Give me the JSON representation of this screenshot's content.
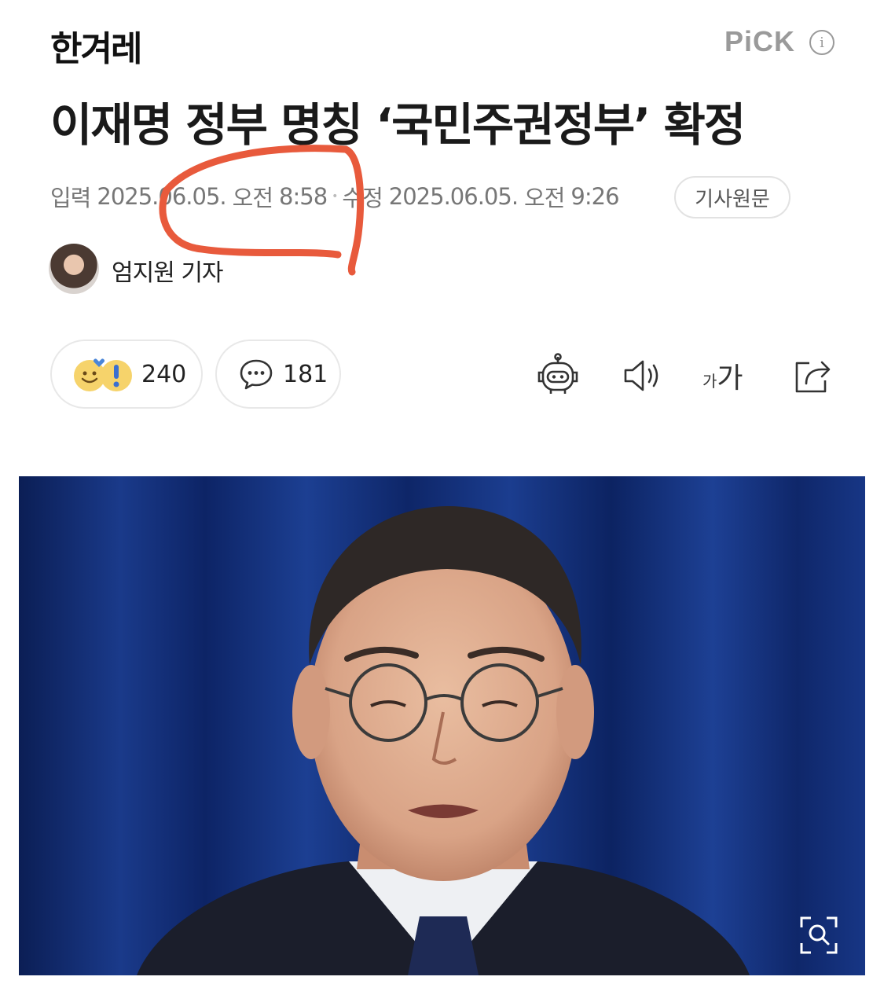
{
  "header": {
    "logo_text": "한겨레",
    "pick_label": "PiCK",
    "pick_info_icon": "info-icon",
    "info_glyph": "i"
  },
  "article": {
    "headline": "이재명 정부 명칭 ‘국민주권정부’ 확정",
    "input_label": "입력",
    "input_date": "2025.06.05.",
    "input_ampm": "오전",
    "input_time": "8:58",
    "edit_label": "수정",
    "edit_date": "2025.06.05.",
    "edit_ampm": "오전",
    "edit_time": "9:26",
    "original_button": "기사원문",
    "author": "엄지원 기자"
  },
  "actions": {
    "reaction_count": "240",
    "comment_count": "181",
    "font_size_label_small": "가",
    "font_size_label_large": "가",
    "icons": [
      "reaction-icon",
      "comment-icon",
      "ai-summary-robot-icon",
      "text-to-speech-icon",
      "font-size-icon",
      "share-icon",
      "image-zoom-icon"
    ]
  },
  "colors": {
    "accent_annotation": "#e85a3c",
    "photo_background": "#122d74",
    "meta_text": "#777777"
  }
}
